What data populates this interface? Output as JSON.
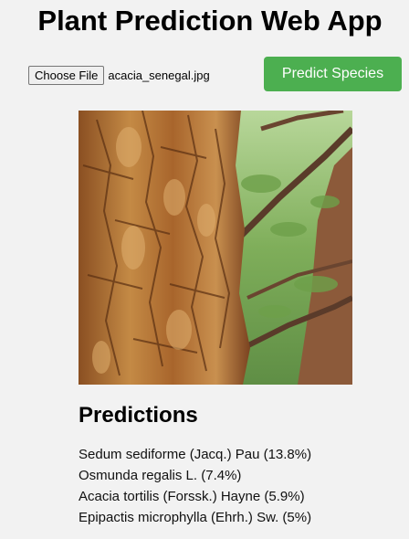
{
  "header": {
    "title": "Plant Prediction Web App"
  },
  "upload": {
    "choose_file_label": "Choose File",
    "file_name": "acacia_senegal.jpg",
    "predict_label": "Predict Species"
  },
  "colors": {
    "accent_green": "#4caf50",
    "background": "#f2f2f2"
  },
  "image": {
    "description_icon": "tree-bark-photo"
  },
  "predictions": {
    "heading": "Predictions",
    "items": [
      "Sedum sediforme (Jacq.) Pau (13.8%)",
      "Osmunda regalis L. (7.4%)",
      "Acacia tortilis (Forssk.) Hayne (5.9%)",
      "Epipactis microphylla (Ehrh.) Sw. (5%)"
    ]
  }
}
